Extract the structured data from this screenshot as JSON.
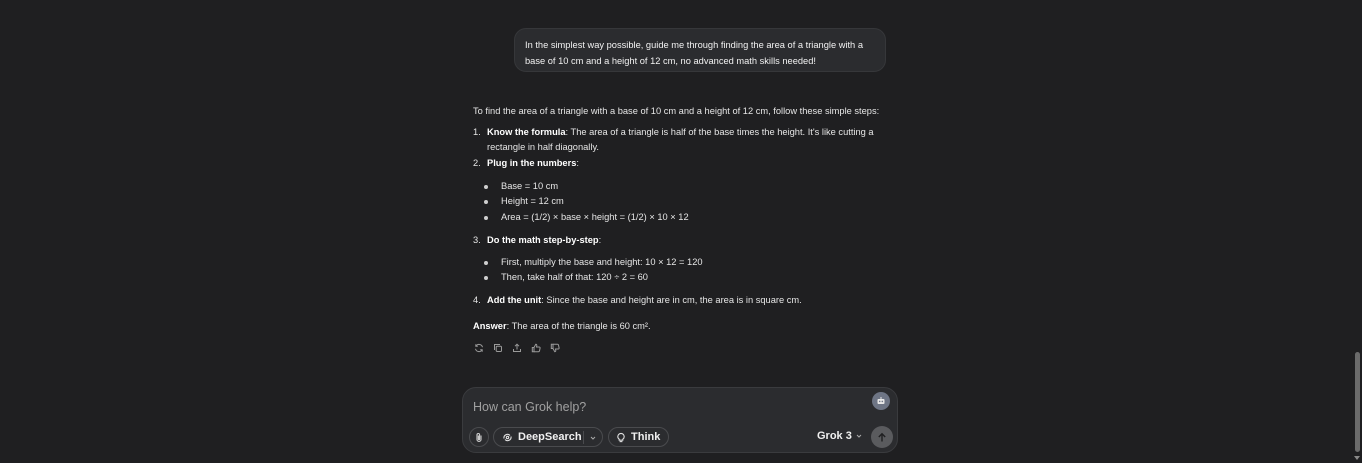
{
  "user_message": {
    "line1": "In the simplest way possible, guide me through finding the area of a triangle with a",
    "line2": "base of 10 cm and a height of 12 cm, no advanced math skills needed!"
  },
  "answer": {
    "intro": "To find the area of a triangle with a base of 10 cm and a height of 12 cm, follow these simple steps:",
    "steps": [
      {
        "num": "1.",
        "title": "Know the formula",
        "text_line1": ": The area of a triangle is half of the base times the height. It's like cutting a",
        "text_line2": "rectangle in half diagonally."
      },
      {
        "num": "2.",
        "title": "Plug in the numbers",
        "text": ":",
        "bullets": [
          "Base = 10 cm",
          "Height = 12 cm",
          "Area = (1/2) × base × height = (1/2) × 10 × 12"
        ]
      },
      {
        "num": "3.",
        "title": "Do the math step-by-step",
        "text": ":",
        "bullets": [
          "First, multiply the base and height: 10 × 12 = 120",
          "Then, take half of that: 120 ÷ 2 = 60"
        ]
      },
      {
        "num": "4.",
        "title": "Add the unit",
        "text": ": Since the base and height are in cm, the area is in square cm."
      }
    ],
    "final_label": "Answer",
    "final_text": ": The area of the triangle is 60 cm²."
  },
  "actions": {
    "icons": [
      "regenerate-icon",
      "copy-icon",
      "share-icon",
      "thumbs-up-icon",
      "thumbs-down-icon"
    ]
  },
  "composer": {
    "placeholder": "How can Grok help?",
    "deepsearch_label": "DeepSearch",
    "think_label": "Think",
    "model_label": "Grok 3"
  },
  "colors": {
    "background": "#1f1f21",
    "bubble": "#2b2c2f",
    "send_button": "#5a5b5e"
  }
}
